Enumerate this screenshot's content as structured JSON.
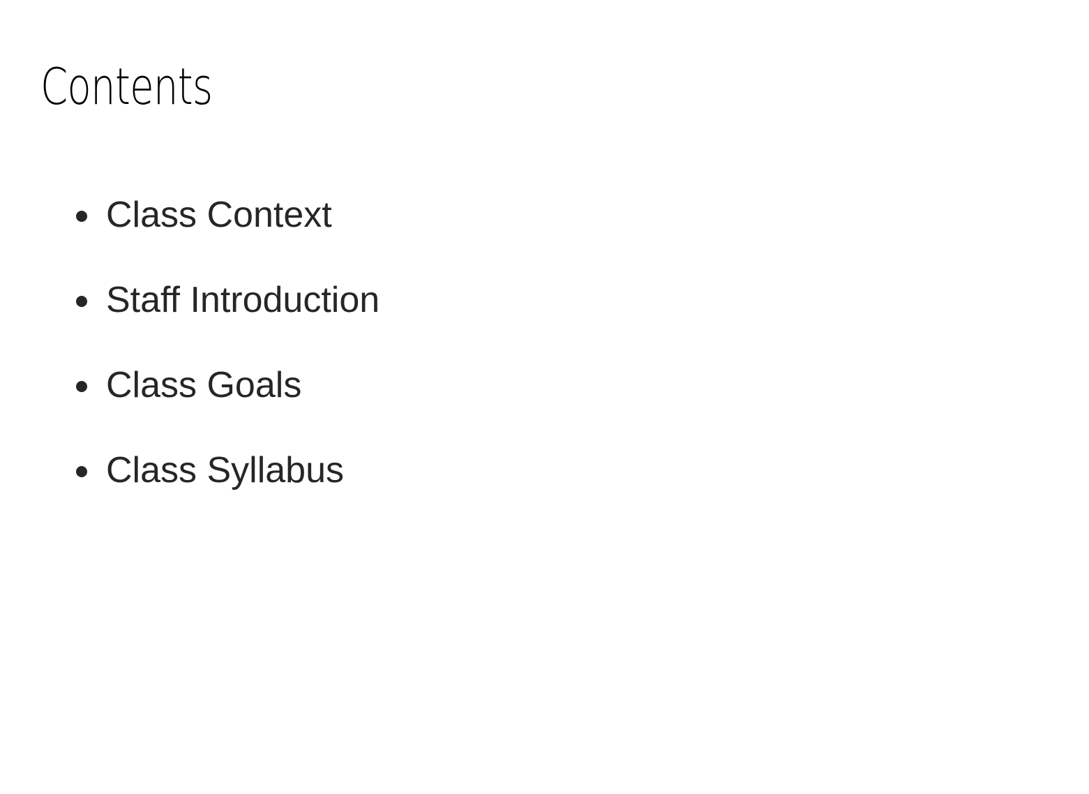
{
  "page": {
    "title": "Contents"
  },
  "toc": {
    "items": [
      {
        "label": "Class Context"
      },
      {
        "label": "Staff Introduction"
      },
      {
        "label": "Class Goals"
      },
      {
        "label": "Class Syllabus"
      }
    ]
  },
  "colors": {
    "title": "#000000",
    "text": "#262626",
    "background": "#ffffff"
  }
}
